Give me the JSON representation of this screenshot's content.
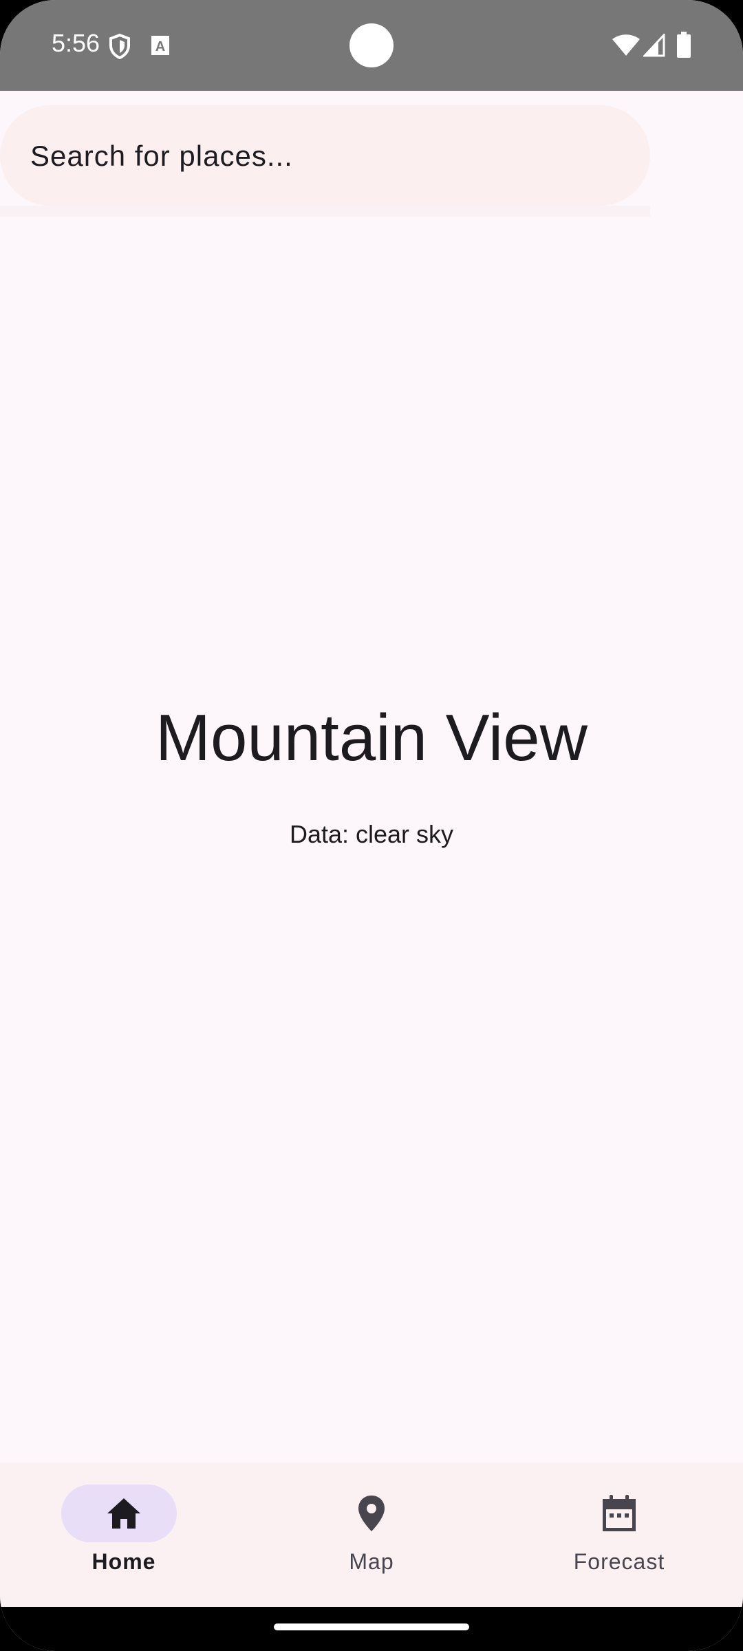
{
  "status_bar": {
    "time": "5:56",
    "icons": [
      "shield-icon",
      "a-text-icon",
      "wifi-icon",
      "signal-icon",
      "battery-icon"
    ]
  },
  "search": {
    "placeholder": "Search for places..."
  },
  "weather": {
    "city": "Mountain View",
    "description": "Data: clear sky"
  },
  "bottom_nav": {
    "items": [
      {
        "label": "Home",
        "icon": "home-icon",
        "active": true
      },
      {
        "label": "Map",
        "icon": "map-pin-icon",
        "active": false
      },
      {
        "label": "Forecast",
        "icon": "calendar-icon",
        "active": false
      }
    ]
  },
  "colors": {
    "background": "#fdf7fb",
    "status_bar": "#777777",
    "search_bg": "#fcefef",
    "nav_bg": "#fbf0f2",
    "active_pill": "#e8def8",
    "text": "#1d1b20"
  }
}
